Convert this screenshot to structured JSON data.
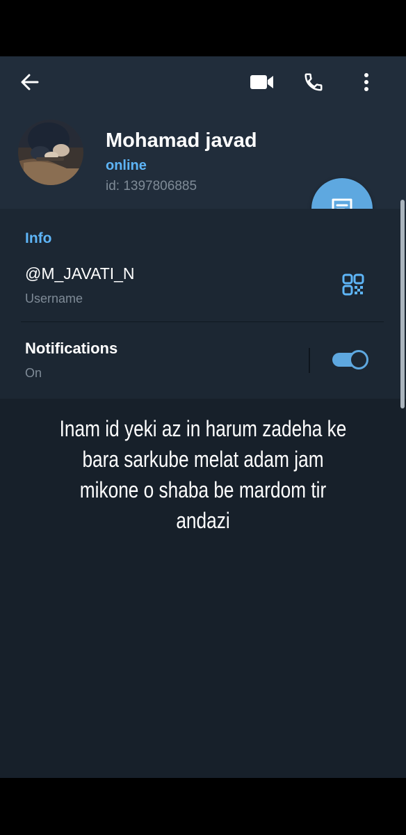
{
  "profile": {
    "name": "Mohamad javad",
    "status": "online",
    "id_text": "id: 1397806885"
  },
  "toolbar": {
    "back_icon": "arrow-left-icon",
    "video_icon": "video-camera-icon",
    "call_icon": "phone-icon",
    "more_icon": "more-vertical-icon"
  },
  "info": {
    "section_title": "Info",
    "username": "@M_JAVATI_N",
    "username_caption": "Username",
    "qr_icon": "qr-code-icon"
  },
  "notifications": {
    "title": "Notifications",
    "state": "On",
    "enabled": true
  },
  "overlay": {
    "caption": "Inam id yeki az in harum zadeha ke bara sarkube melat adam jam mikone o shaba be mardom tir andazi"
  },
  "colors": {
    "header_bg": "#212d3b",
    "section_bg": "#1c2733",
    "body_bg": "#17202a",
    "accent": "#5eb5f7",
    "fab": "#5ea8e0",
    "muted_text": "#7f8b97"
  }
}
